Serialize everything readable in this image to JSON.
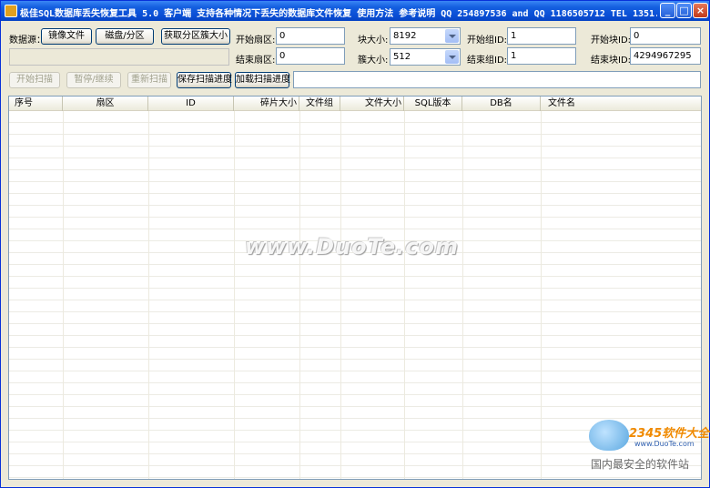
{
  "window": {
    "title": "极佳SQL数据库丢失恢复工具 5.0 客户端 支持各种情况下丢失的数据库文件恢复 使用方法 参考说明 QQ 254897536 and QQ 1186505712 TEL 1351..."
  },
  "toolbar": {
    "datasource_label": "数据源：",
    "image_file_button": "镜像文件",
    "disk_partition_button": "磁盘/分区",
    "get_cluster_size_button": "获取分区簇大小",
    "start_sector_label": "开始扇区:",
    "start_sector_value": "0",
    "end_sector_label": "结束扇区:",
    "end_sector_value": "0",
    "block_size_label": "块大小:",
    "block_size_value": "8192",
    "cluster_size_label": "簇大小:",
    "cluster_size_value": "512",
    "start_group_label": "开始组ID:",
    "start_group_value": "1",
    "end_group_label": "结束组ID:",
    "end_group_value": "1",
    "start_block_label": "开始块ID:",
    "start_block_value": "0",
    "end_block_label": "结束块ID:",
    "end_block_value": "4294967295",
    "path_value": ""
  },
  "actions": {
    "start_scan": "开始扫描",
    "pause_continue": "暂停/继续",
    "rescan": "重新扫描",
    "save_progress": "保存扫描进度",
    "load_progress": "加载扫描进度",
    "status_value": ""
  },
  "table": {
    "columns": [
      "序号",
      "扇区",
      "ID",
      "碎片大小",
      "文件组",
      "文件大小",
      "SQL版本",
      "DB名",
      "文件名"
    ]
  },
  "watermark": {
    "text": "www.DuoTe.com"
  },
  "logo": {
    "brand": "2345软件大全",
    "url": "www.DuoTe.com",
    "slogan": "国内最安全的软件站"
  },
  "colors": {
    "titlebar": "#0a4fd6",
    "window_bg": "#ece9d8",
    "close_button": "#c0391a"
  }
}
